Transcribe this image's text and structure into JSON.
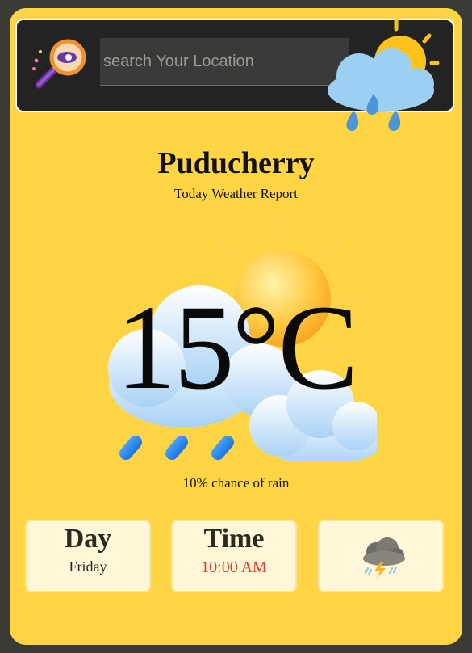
{
  "search": {
    "placeholder": "search Your Location",
    "value": "",
    "icon": "search-magnifier-icon"
  },
  "header_icon": "cloud-sun-rain-icon",
  "location": {
    "city": "Puducherry",
    "subtitle": "Today Weather Report"
  },
  "current": {
    "icon": "sun-cloud-rain-icon",
    "temperature": "15°C",
    "rain_chance": "10% chance of rain"
  },
  "cards": {
    "day": {
      "title": "Day",
      "value": "Friday"
    },
    "time": {
      "title": "Time",
      "value": "10:00 AM"
    },
    "condition": {
      "icon": "thunderstorm-icon"
    }
  },
  "colors": {
    "background": "#3b3b36",
    "card": "#ffd546",
    "search_bar": "#232323",
    "info_box": "#fff7d8",
    "time_text": "#e03a2a"
  }
}
